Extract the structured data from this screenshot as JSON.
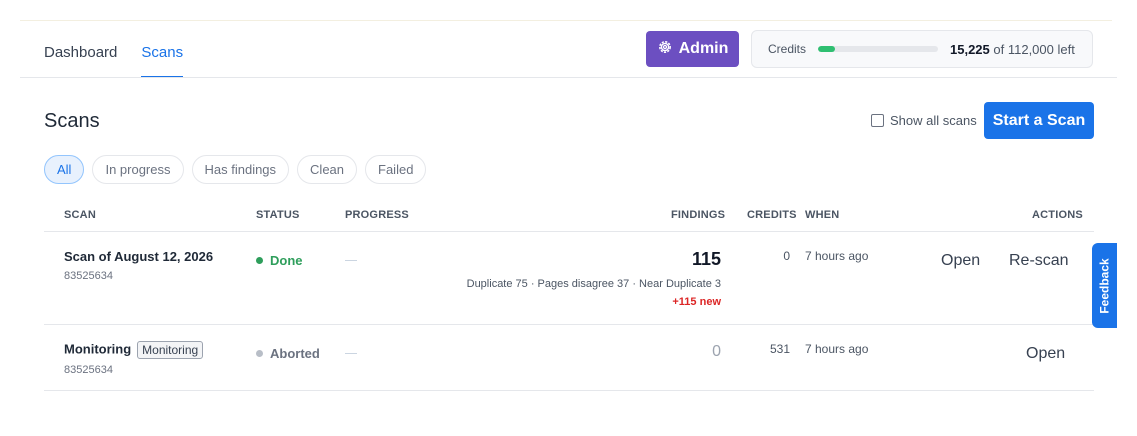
{
  "nav": {
    "tabs": [
      {
        "label": "Dashboard",
        "active": false
      },
      {
        "label": "Scans",
        "active": true
      }
    ]
  },
  "admin": {
    "label": "Admin",
    "icon": "gear-icon",
    "color": "#6c4fc1"
  },
  "credits": {
    "label": "Credits",
    "used_fraction": 0.14,
    "remaining": "15,225",
    "total_text": "of 112,000 left",
    "bar_color": "#2fbf71"
  },
  "page": {
    "title": "Scans",
    "show_all_label": "Show all scans",
    "start_scan_label": "Start a Scan"
  },
  "filters": [
    {
      "label": "All",
      "active": true
    },
    {
      "label": "In progress",
      "active": false
    },
    {
      "label": "Has findings",
      "active": false
    },
    {
      "label": "Clean",
      "active": false
    },
    {
      "label": "Failed",
      "active": false
    }
  ],
  "table": {
    "headers": {
      "scan": "SCAN",
      "status": "STATUS",
      "progress": "PROGRESS",
      "findings": "FINDINGS",
      "credits": "CREDITS",
      "when": "WHEN",
      "actions": "ACTIONS"
    },
    "rows": [
      {
        "name": "Scan of August 12, 2026",
        "badge": "",
        "id": "83525634",
        "status": "Done",
        "status_color": "#2e9e5b",
        "progress": "—",
        "findings": "115",
        "findings_detail": "Duplicate 75 · Pages disagree 37 · Near Duplicate 3",
        "findings_new": "+115 new",
        "credits": "0",
        "when": "7 hours ago",
        "actions": [
          "Open",
          "Re-scan"
        ]
      },
      {
        "name": "Monitoring",
        "badge": "Monitoring",
        "id": "83525634",
        "status": "Aborted",
        "status_color": "#b8bec7",
        "progress": "—",
        "findings": "0",
        "findings_detail": "",
        "findings_new": "",
        "credits": "531",
        "when": "7 hours ago",
        "actions": [
          "Open"
        ]
      }
    ]
  },
  "feedback": {
    "label": "Feedback"
  }
}
